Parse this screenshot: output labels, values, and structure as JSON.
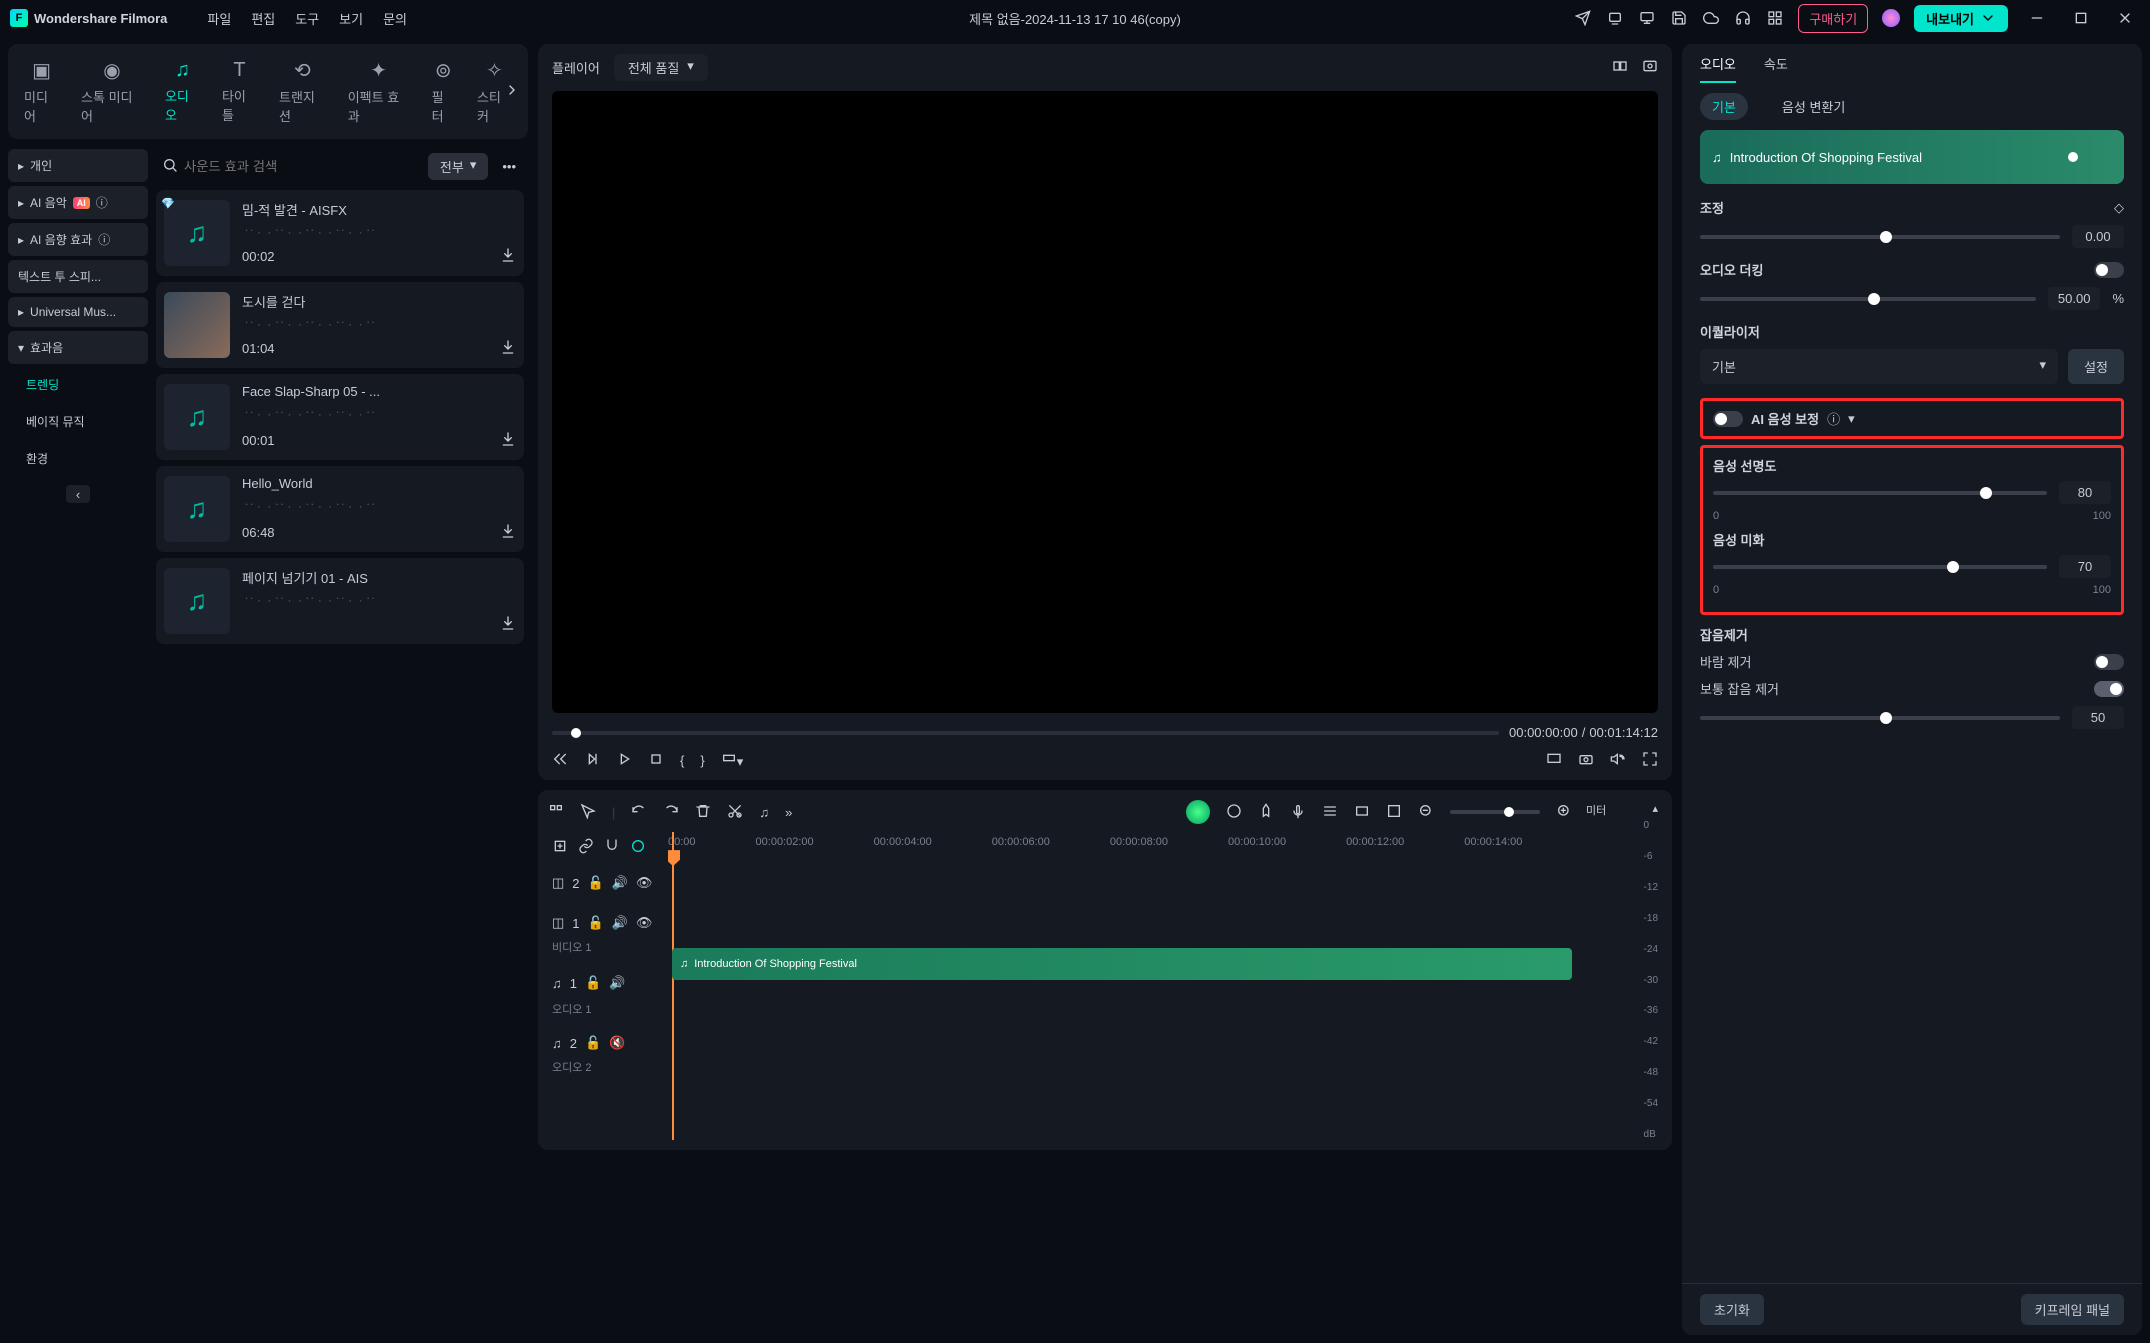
{
  "app": {
    "name": "Wondershare Filmora",
    "doc_title": "제목 없음-2024-11-13 17 10 46(copy)"
  },
  "menu": {
    "file": "파일",
    "edit": "편집",
    "tools": "도구",
    "view": "보기",
    "help": "문의"
  },
  "titlebar": {
    "purchase": "구매하기",
    "export": "내보내기"
  },
  "nav_tabs": [
    "미디어",
    "스톡 미디어",
    "오디오",
    "타이틀",
    "트랜지션",
    "이펙트 효과",
    "필터",
    "스티커"
  ],
  "sidebar": {
    "items": [
      "개인",
      "AI 음악",
      "AI 음향 효과",
      "텍스트 투 스피...",
      "Universal Mus...",
      "효과음"
    ],
    "subs": [
      "트렌딩",
      "베이직 뮤직",
      "환경"
    ],
    "ai_badge": "AI"
  },
  "search": {
    "placeholder": "사운드 효과 검색",
    "filter": "전부"
  },
  "list": [
    {
      "title": "밈-적 발견 - AISFX",
      "dur": "00:02",
      "diamond": true
    },
    {
      "title": "도시를 걷다",
      "dur": "01:04",
      "photo": true
    },
    {
      "title": "Face Slap-Sharp 05 - ...",
      "dur": "00:01"
    },
    {
      "title": "Hello_World",
      "dur": "06:48"
    },
    {
      "title": "페이지 넘기기 01 - AIS",
      "dur": ""
    }
  ],
  "player": {
    "label": "플레이어",
    "quality": "전체 품질",
    "cur": "00:00:00:00",
    "sep": "/",
    "total": "00:01:14:12"
  },
  "right": {
    "tabs": [
      "오디오",
      "속도"
    ],
    "subtabs": [
      "기본",
      "음성 변환기"
    ],
    "clip_name": "Introduction Of Shopping Festival",
    "adjust": {
      "label": "조정",
      "value": "0.00"
    },
    "ducking": {
      "label": "오디오 더킹",
      "value": "50.00",
      "unit": "%"
    },
    "eq": {
      "label": "이퀄라이저",
      "preset": "기본",
      "settings": "설정"
    },
    "ai_voice": {
      "label": "AI 음성 보정"
    },
    "clarity": {
      "label": "음성 선명도",
      "value": "80",
      "min": "0",
      "max": "100"
    },
    "beautify": {
      "label": "음성 미화",
      "value": "70",
      "min": "0",
      "max": "100"
    },
    "denoise": {
      "label": "잡음제거"
    },
    "wind": {
      "label": "바람 제거"
    },
    "normal_noise": {
      "label": "보통 잡음 제거",
      "value": "50"
    },
    "reset": "초기화",
    "keyframe_panel": "키프레임 패널"
  },
  "timeline": {
    "meter": "미터",
    "ruler": [
      "00:00",
      "00:00:02:00",
      "00:00:04:00",
      "00:00:06:00",
      "00:00:08:00",
      "00:00:10:00",
      "00:00:12:00",
      "00:00:14:00"
    ],
    "tracks": {
      "v2": "2",
      "v1": "1",
      "v1_label": "비디오 1",
      "a1": "1",
      "a1_label": "오디오 1",
      "a2": "2",
      "a2_label": "오디오 2"
    },
    "clip": "Introduction Of Shopping Festival",
    "db": [
      "0",
      "-6",
      "-12",
      "-18",
      "-24",
      "-30",
      "-36",
      "-42",
      "-48",
      "-54",
      "dB"
    ]
  }
}
